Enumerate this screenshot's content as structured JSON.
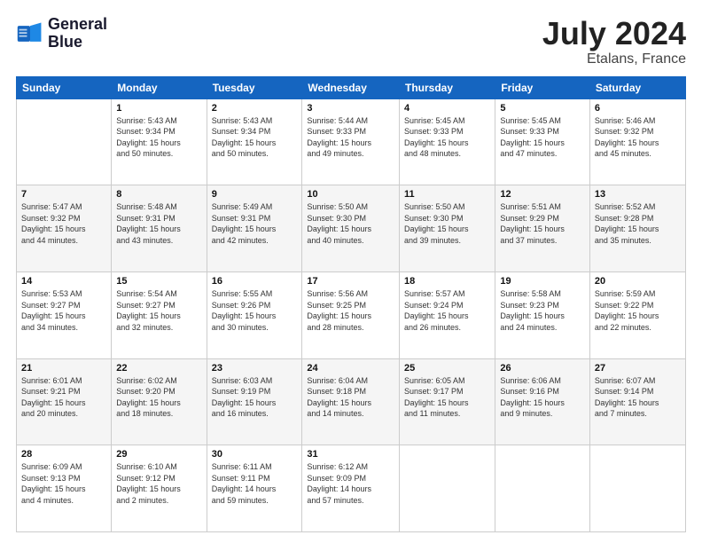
{
  "logo": {
    "line1": "General",
    "line2": "Blue"
  },
  "header": {
    "month": "July 2024",
    "location": "Etalans, France"
  },
  "weekdays": [
    "Sunday",
    "Monday",
    "Tuesday",
    "Wednesday",
    "Thursday",
    "Friday",
    "Saturday"
  ],
  "weeks": [
    [
      {
        "num": "",
        "info": ""
      },
      {
        "num": "1",
        "info": "Sunrise: 5:43 AM\nSunset: 9:34 PM\nDaylight: 15 hours\nand 50 minutes."
      },
      {
        "num": "2",
        "info": "Sunrise: 5:43 AM\nSunset: 9:34 PM\nDaylight: 15 hours\nand 50 minutes."
      },
      {
        "num": "3",
        "info": "Sunrise: 5:44 AM\nSunset: 9:33 PM\nDaylight: 15 hours\nand 49 minutes."
      },
      {
        "num": "4",
        "info": "Sunrise: 5:45 AM\nSunset: 9:33 PM\nDaylight: 15 hours\nand 48 minutes."
      },
      {
        "num": "5",
        "info": "Sunrise: 5:45 AM\nSunset: 9:33 PM\nDaylight: 15 hours\nand 47 minutes."
      },
      {
        "num": "6",
        "info": "Sunrise: 5:46 AM\nSunset: 9:32 PM\nDaylight: 15 hours\nand 45 minutes."
      }
    ],
    [
      {
        "num": "7",
        "info": "Sunrise: 5:47 AM\nSunset: 9:32 PM\nDaylight: 15 hours\nand 44 minutes."
      },
      {
        "num": "8",
        "info": "Sunrise: 5:48 AM\nSunset: 9:31 PM\nDaylight: 15 hours\nand 43 minutes."
      },
      {
        "num": "9",
        "info": "Sunrise: 5:49 AM\nSunset: 9:31 PM\nDaylight: 15 hours\nand 42 minutes."
      },
      {
        "num": "10",
        "info": "Sunrise: 5:50 AM\nSunset: 9:30 PM\nDaylight: 15 hours\nand 40 minutes."
      },
      {
        "num": "11",
        "info": "Sunrise: 5:50 AM\nSunset: 9:30 PM\nDaylight: 15 hours\nand 39 minutes."
      },
      {
        "num": "12",
        "info": "Sunrise: 5:51 AM\nSunset: 9:29 PM\nDaylight: 15 hours\nand 37 minutes."
      },
      {
        "num": "13",
        "info": "Sunrise: 5:52 AM\nSunset: 9:28 PM\nDaylight: 15 hours\nand 35 minutes."
      }
    ],
    [
      {
        "num": "14",
        "info": "Sunrise: 5:53 AM\nSunset: 9:27 PM\nDaylight: 15 hours\nand 34 minutes."
      },
      {
        "num": "15",
        "info": "Sunrise: 5:54 AM\nSunset: 9:27 PM\nDaylight: 15 hours\nand 32 minutes."
      },
      {
        "num": "16",
        "info": "Sunrise: 5:55 AM\nSunset: 9:26 PM\nDaylight: 15 hours\nand 30 minutes."
      },
      {
        "num": "17",
        "info": "Sunrise: 5:56 AM\nSunset: 9:25 PM\nDaylight: 15 hours\nand 28 minutes."
      },
      {
        "num": "18",
        "info": "Sunrise: 5:57 AM\nSunset: 9:24 PM\nDaylight: 15 hours\nand 26 minutes."
      },
      {
        "num": "19",
        "info": "Sunrise: 5:58 AM\nSunset: 9:23 PM\nDaylight: 15 hours\nand 24 minutes."
      },
      {
        "num": "20",
        "info": "Sunrise: 5:59 AM\nSunset: 9:22 PM\nDaylight: 15 hours\nand 22 minutes."
      }
    ],
    [
      {
        "num": "21",
        "info": "Sunrise: 6:01 AM\nSunset: 9:21 PM\nDaylight: 15 hours\nand 20 minutes."
      },
      {
        "num": "22",
        "info": "Sunrise: 6:02 AM\nSunset: 9:20 PM\nDaylight: 15 hours\nand 18 minutes."
      },
      {
        "num": "23",
        "info": "Sunrise: 6:03 AM\nSunset: 9:19 PM\nDaylight: 15 hours\nand 16 minutes."
      },
      {
        "num": "24",
        "info": "Sunrise: 6:04 AM\nSunset: 9:18 PM\nDaylight: 15 hours\nand 14 minutes."
      },
      {
        "num": "25",
        "info": "Sunrise: 6:05 AM\nSunset: 9:17 PM\nDaylight: 15 hours\nand 11 minutes."
      },
      {
        "num": "26",
        "info": "Sunrise: 6:06 AM\nSunset: 9:16 PM\nDaylight: 15 hours\nand 9 minutes."
      },
      {
        "num": "27",
        "info": "Sunrise: 6:07 AM\nSunset: 9:14 PM\nDaylight: 15 hours\nand 7 minutes."
      }
    ],
    [
      {
        "num": "28",
        "info": "Sunrise: 6:09 AM\nSunset: 9:13 PM\nDaylight: 15 hours\nand 4 minutes."
      },
      {
        "num": "29",
        "info": "Sunrise: 6:10 AM\nSunset: 9:12 PM\nDaylight: 15 hours\nand 2 minutes."
      },
      {
        "num": "30",
        "info": "Sunrise: 6:11 AM\nSunset: 9:11 PM\nDaylight: 14 hours\nand 59 minutes."
      },
      {
        "num": "31",
        "info": "Sunrise: 6:12 AM\nSunset: 9:09 PM\nDaylight: 14 hours\nand 57 minutes."
      },
      {
        "num": "",
        "info": ""
      },
      {
        "num": "",
        "info": ""
      },
      {
        "num": "",
        "info": ""
      }
    ]
  ]
}
